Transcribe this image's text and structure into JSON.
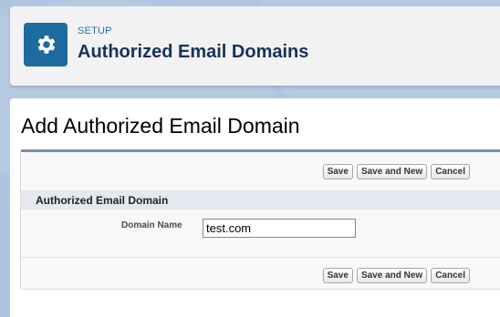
{
  "header": {
    "setup_label": "SETUP",
    "title": "Authorized Email Domains",
    "icon": "gear-icon",
    "icon_color": "#1d6b9f"
  },
  "page": {
    "title": "Add Authorized Email Domain"
  },
  "buttons": {
    "save": "Save",
    "save_and_new": "Save and New",
    "cancel": "Cancel"
  },
  "section": {
    "title": "Authorized Email Domain"
  },
  "form": {
    "domain_label": "Domain Name",
    "domain_value": "test.com"
  }
}
